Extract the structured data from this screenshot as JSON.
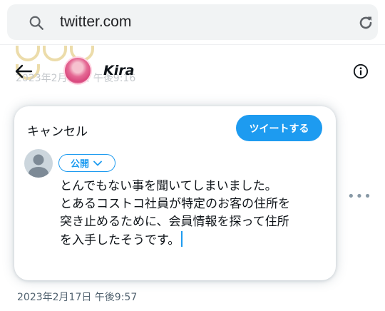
{
  "browser": {
    "url": "twitter.com",
    "search_icon": "search-icon",
    "reload_icon": "reload-icon"
  },
  "background": {
    "profile_name": "Kira",
    "ghost_date": "2023年2月17日 午後9:16",
    "tweet_date": "2023年2月17日 午後9:57",
    "more_label": "•••"
  },
  "compose": {
    "cancel_label": "キャンセル",
    "tweet_button_label": "ツイートする",
    "audience_label": "公開",
    "text": "とんでもない事を聞いてしまいました。\nとあるコストコ社員が特定のお客の住所を\n突き止めるために、会員情報を探って住所\nを入手したそうです。"
  },
  "colors": {
    "accent": "#1d9bf0",
    "text": "#0f1419",
    "muted": "#536471"
  }
}
